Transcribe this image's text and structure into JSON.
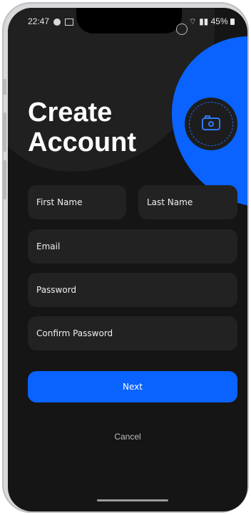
{
  "status": {
    "time": "22:47",
    "battery": "45%"
  },
  "title": {
    "line1": "Create",
    "line2": "Account"
  },
  "form": {
    "first_name_placeholder": "First Name",
    "last_name_placeholder": "Last Name",
    "email_placeholder": "Email",
    "password_placeholder": "Password",
    "confirm_password_placeholder": "Confirm Password"
  },
  "actions": {
    "next_label": "Next",
    "cancel_label": "Cancel"
  },
  "colors": {
    "accent": "#0a63ff",
    "background": "#151515",
    "field": "#222222"
  },
  "icons": {
    "avatar": "camera-icon"
  }
}
